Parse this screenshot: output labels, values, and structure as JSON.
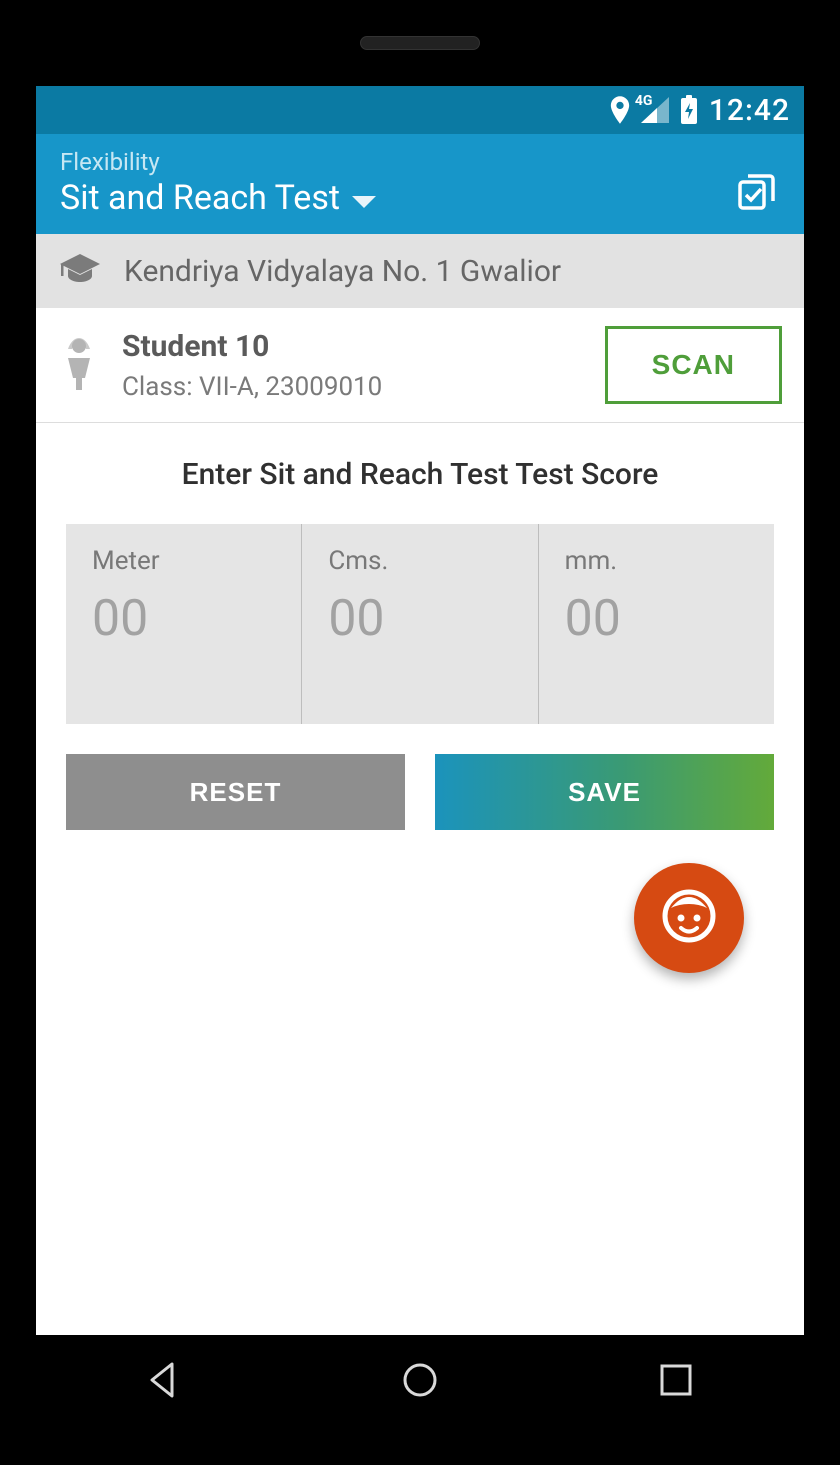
{
  "status": {
    "time": "12:42",
    "network_label": "4G"
  },
  "appbar": {
    "subtitle": "Flexibility",
    "title": "Sit and Reach Test"
  },
  "school": {
    "name": "Kendriya Vidyalaya No. 1 Gwalior"
  },
  "student": {
    "name": "Student 10",
    "meta": "Class: VII-A, 23009010",
    "scan_label": "SCAN"
  },
  "form": {
    "prompt": "Enter Sit and Reach Test Test Score",
    "fields": [
      {
        "label": "Meter",
        "value": "00"
      },
      {
        "label": "Cms.",
        "value": "00"
      },
      {
        "label": "mm.",
        "value": "00"
      }
    ],
    "reset_label": "RESET",
    "save_label": "SAVE"
  }
}
